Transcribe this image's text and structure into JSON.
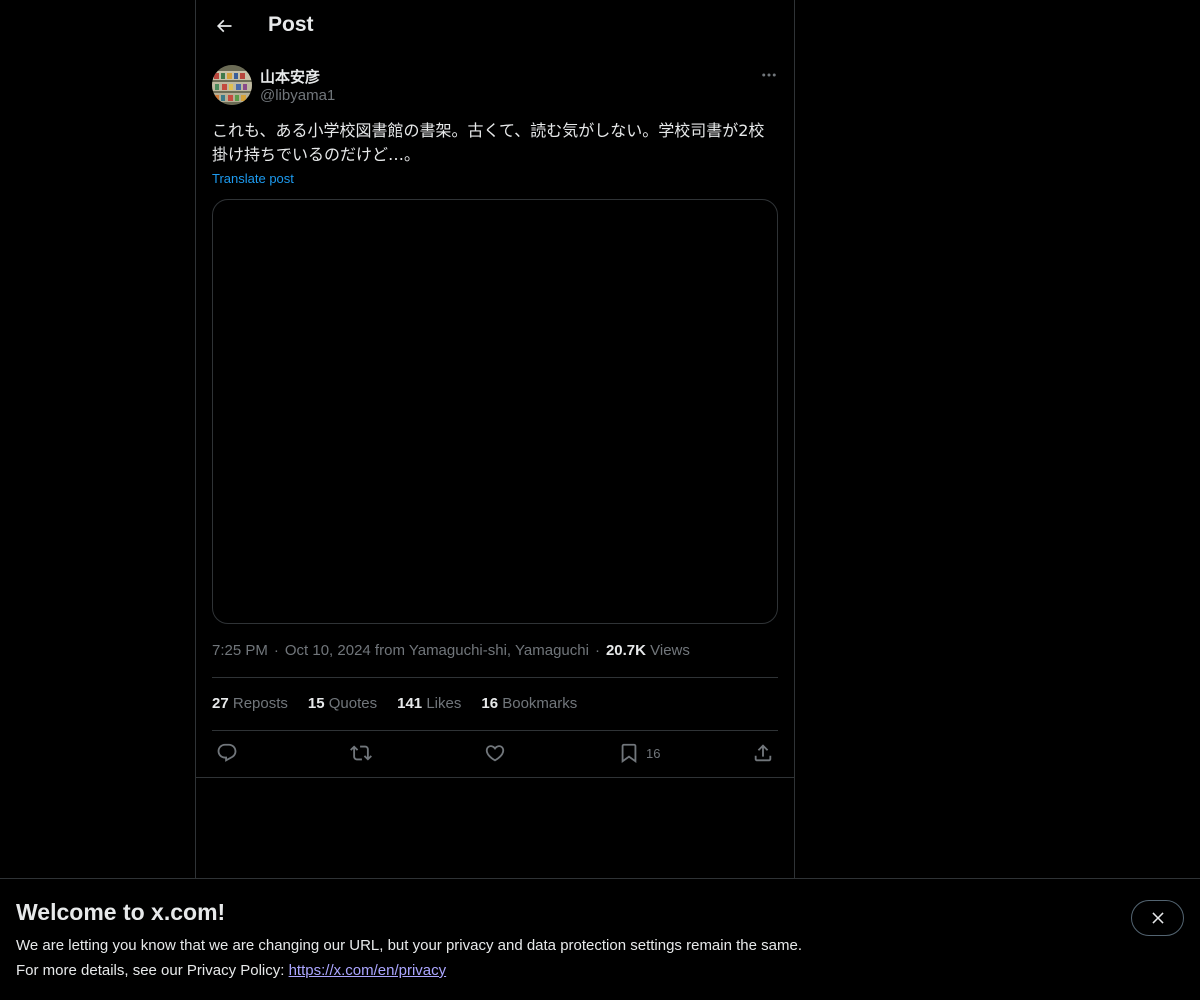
{
  "header": {
    "title": "Post"
  },
  "post": {
    "display_name": "山本安彦",
    "handle": "@libyama1",
    "text": "これも、ある小学校図書館の書架。古くて、読む気がしない。学校司書が2校掛け持ちでいるのだけど…。",
    "translate_label": "Translate post",
    "time": "7:25 PM",
    "date_location": "Oct 10, 2024 from Yamaguchi-shi, Yamaguchi",
    "views_count": "20.7K",
    "views_label": "Views"
  },
  "stats": {
    "reposts": {
      "count": "27",
      "label": "Reposts"
    },
    "quotes": {
      "count": "15",
      "label": "Quotes"
    },
    "likes": {
      "count": "141",
      "label": "Likes"
    },
    "bookmarks": {
      "count": "16",
      "label": "Bookmarks"
    }
  },
  "actions": {
    "bookmark_count": "16"
  },
  "banner": {
    "title": "Welcome to x.com!",
    "line1": "We are letting you know that we are changing our URL, but your privacy and data protection settings remain the same.",
    "line2_prefix": "For more details, see our Privacy Policy: ",
    "link": "https://x.com/en/privacy"
  },
  "colors": {
    "background": "#000000",
    "text": "#e7e9ea",
    "muted": "#71767b",
    "link": "#1d9bf0",
    "border": "#2f3336",
    "banner_link": "#aba6ff"
  }
}
